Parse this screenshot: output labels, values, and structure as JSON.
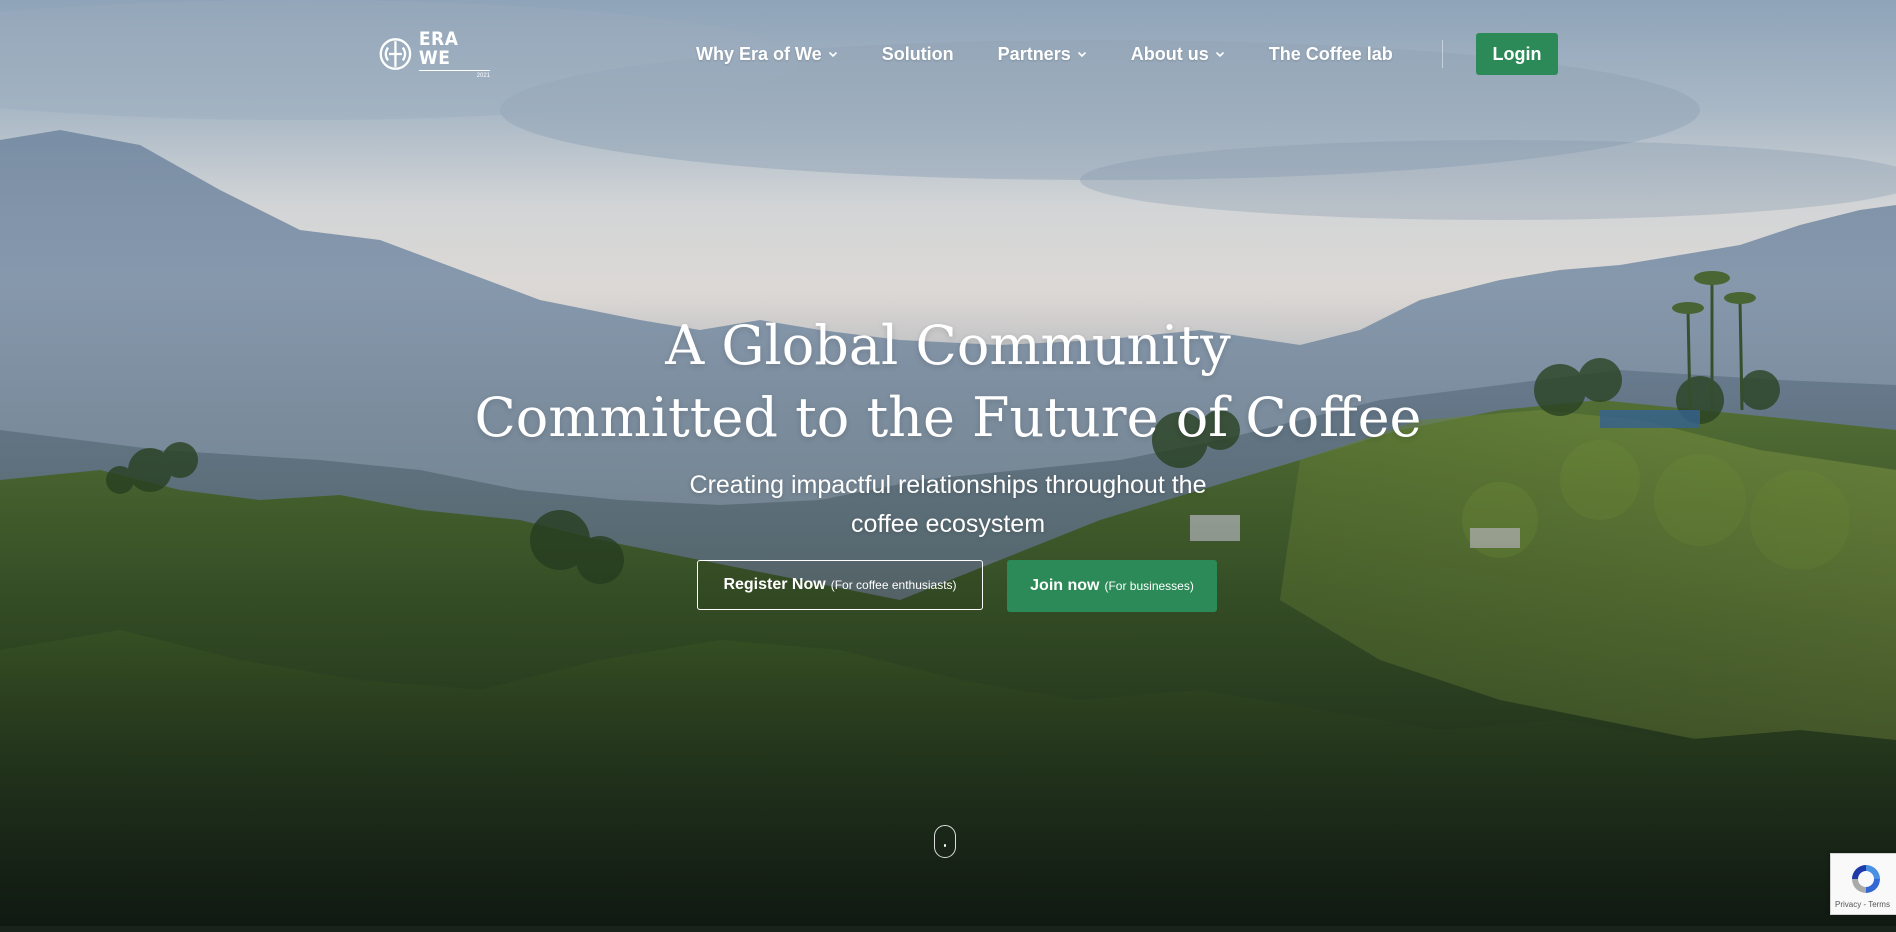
{
  "brand": {
    "logo_word": "ERA WE",
    "logo_sub": "2021",
    "icon": "era-of-we-logo-icon"
  },
  "nav": {
    "items": [
      {
        "label": "Why Era of We",
        "has_dropdown": true
      },
      {
        "label": "Solution",
        "has_dropdown": false
      },
      {
        "label": "Partners",
        "has_dropdown": true
      },
      {
        "label": "About us",
        "has_dropdown": true
      },
      {
        "label": "The Coffee lab",
        "has_dropdown": false
      }
    ],
    "login_label": "Login"
  },
  "hero": {
    "title_line1": "A Global Community",
    "title_line2": "Committed to the Future of Coffee",
    "subtitle_line1": "Creating impactful relationships throughout the",
    "subtitle_line2": "coffee ecosystem",
    "register": {
      "label": "Register Now",
      "note": "(For coffee enthusiasts)"
    },
    "join": {
      "label": "Join now",
      "note": "(For businesses)"
    }
  },
  "recaptcha": {
    "text": "Privacy - Terms"
  },
  "colors": {
    "accent_green": "#2b8a57",
    "text_white": "#ffffff"
  }
}
